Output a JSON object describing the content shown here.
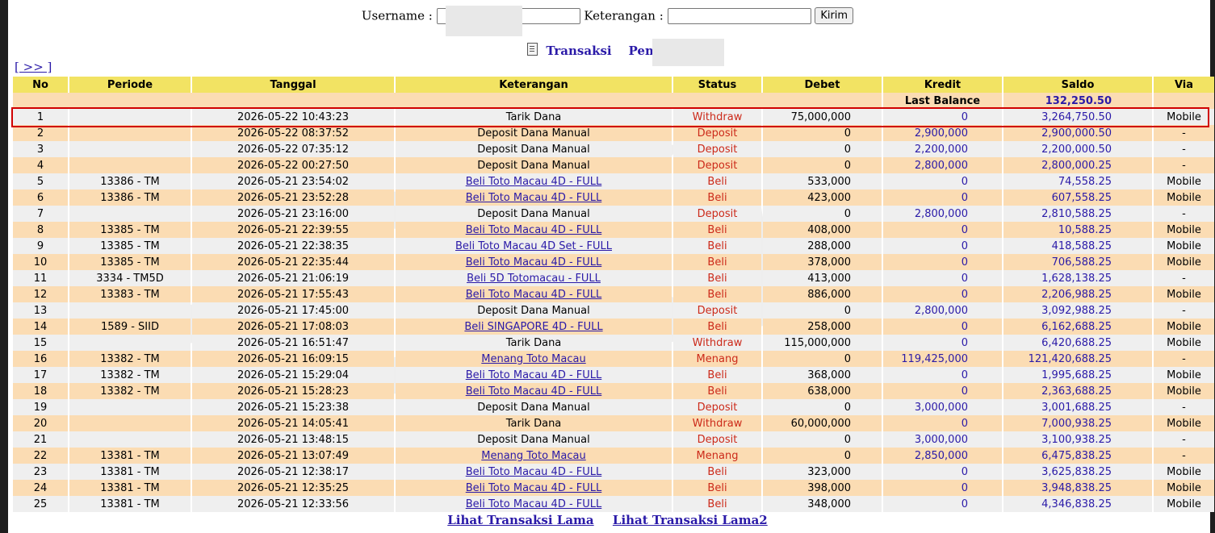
{
  "form": {
    "username_label": "Username :",
    "keterangan_label": "Keterangan :",
    "submit_label": "Kirim"
  },
  "title": {
    "transaksi": "Transaksi",
    "pemain": "Pemain :"
  },
  "nav": {
    "next": "[ >> ]"
  },
  "table": {
    "headers": [
      "No",
      "Periode",
      "Tanggal",
      "Keterangan",
      "Status",
      "Debet",
      "Kredit",
      "Saldo",
      "Via"
    ],
    "last_balance_label": "Last Balance",
    "last_balance_value": "132,250.50",
    "rows": [
      {
        "no": "1",
        "periode": "",
        "tanggal": "2026-05-22 10:43:23",
        "keterangan": "Tarik Dana",
        "link": false,
        "status": "Withdraw",
        "debet": "75,000,000",
        "kredit": "0",
        "saldo": "3,264,750.50",
        "via": "Mobile"
      },
      {
        "no": "2",
        "periode": "",
        "tanggal": "2026-05-22 08:37:52",
        "keterangan": "Deposit Dana Manual",
        "link": false,
        "status": "Deposit",
        "debet": "0",
        "kredit": "2,900,000",
        "saldo": "2,900,000.50",
        "via": "-"
      },
      {
        "no": "3",
        "periode": "",
        "tanggal": "2026-05-22 07:35:12",
        "keterangan": "Deposit Dana Manual",
        "link": false,
        "status": "Deposit",
        "debet": "0",
        "kredit": "2,200,000",
        "saldo": "2,200,000.50",
        "via": "-"
      },
      {
        "no": "4",
        "periode": "",
        "tanggal": "2026-05-22 00:27:50",
        "keterangan": "Deposit Dana Manual",
        "link": false,
        "status": "Deposit",
        "debet": "0",
        "kredit": "2,800,000",
        "saldo": "2,800,000.25",
        "via": "-"
      },
      {
        "no": "5",
        "periode": "13386 - TM",
        "tanggal": "2026-05-21 23:54:02",
        "keterangan": "Beli Toto Macau 4D - FULL",
        "link": true,
        "status": "Beli",
        "debet": "533,000",
        "kredit": "0",
        "saldo": "74,558.25",
        "via": "Mobile"
      },
      {
        "no": "6",
        "periode": "13386 - TM",
        "tanggal": "2026-05-21 23:52:28",
        "keterangan": "Beli Toto Macau 4D - FULL",
        "link": true,
        "status": "Beli",
        "debet": "423,000",
        "kredit": "0",
        "saldo": "607,558.25",
        "via": "Mobile"
      },
      {
        "no": "7",
        "periode": "",
        "tanggal": "2026-05-21 23:16:00",
        "keterangan": "Deposit Dana Manual",
        "link": false,
        "status": "Deposit",
        "debet": "0",
        "kredit": "2,800,000",
        "saldo": "2,810,588.25",
        "via": "-"
      },
      {
        "no": "8",
        "periode": "13385 - TM",
        "tanggal": "2026-05-21 22:39:55",
        "keterangan": "Beli Toto Macau 4D - FULL",
        "link": true,
        "status": "Beli",
        "debet": "408,000",
        "kredit": "0",
        "saldo": "10,588.25",
        "via": "Mobile"
      },
      {
        "no": "9",
        "periode": "13385 - TM",
        "tanggal": "2026-05-21 22:38:35",
        "keterangan": "Beli Toto Macau 4D Set - FULL",
        "link": true,
        "status": "Beli",
        "debet": "288,000",
        "kredit": "0",
        "saldo": "418,588.25",
        "via": "Mobile"
      },
      {
        "no": "10",
        "periode": "13385 - TM",
        "tanggal": "2026-05-21 22:35:44",
        "keterangan": "Beli Toto Macau 4D - FULL",
        "link": true,
        "status": "Beli",
        "debet": "378,000",
        "kredit": "0",
        "saldo": "706,588.25",
        "via": "Mobile"
      },
      {
        "no": "11",
        "periode": "3334 - TM5D",
        "tanggal": "2026-05-21 21:06:19",
        "keterangan": "Beli 5D Totomacau - FULL",
        "link": true,
        "status": "Beli",
        "debet": "413,000",
        "kredit": "0",
        "saldo": "1,628,138.25",
        "via": "-"
      },
      {
        "no": "12",
        "periode": "13383 - TM",
        "tanggal": "2026-05-21 17:55:43",
        "keterangan": "Beli Toto Macau 4D - FULL",
        "link": true,
        "status": "Beli",
        "debet": "886,000",
        "kredit": "0",
        "saldo": "2,206,988.25",
        "via": "Mobile"
      },
      {
        "no": "13",
        "periode": "",
        "tanggal": "2026-05-21 17:45:00",
        "keterangan": "Deposit Dana Manual",
        "link": false,
        "status": "Deposit",
        "debet": "0",
        "kredit": "2,800,000",
        "saldo": "3,092,988.25",
        "via": "-"
      },
      {
        "no": "14",
        "periode": "1589 - SIID",
        "tanggal": "2026-05-21 17:08:03",
        "keterangan": "Beli SINGAPORE 4D - FULL",
        "link": true,
        "status": "Beli",
        "debet": "258,000",
        "kredit": "0",
        "saldo": "6,162,688.25",
        "via": "Mobile"
      },
      {
        "no": "15",
        "periode": "",
        "tanggal": "2026-05-21 16:51:47",
        "keterangan": "Tarik Dana",
        "link": false,
        "status": "Withdraw",
        "debet": "115,000,000",
        "kredit": "0",
        "saldo": "6,420,688.25",
        "via": "Mobile"
      },
      {
        "no": "16",
        "periode": "13382 - TM",
        "tanggal": "2026-05-21 16:09:15",
        "keterangan": "Menang Toto Macau",
        "link": true,
        "status": "Menang",
        "debet": "0",
        "kredit": "119,425,000",
        "saldo": "121,420,688.25",
        "via": "-"
      },
      {
        "no": "17",
        "periode": "13382 - TM",
        "tanggal": "2026-05-21 15:29:04",
        "keterangan": "Beli Toto Macau 4D - FULL",
        "link": true,
        "status": "Beli",
        "debet": "368,000",
        "kredit": "0",
        "saldo": "1,995,688.25",
        "via": "Mobile"
      },
      {
        "no": "18",
        "periode": "13382 - TM",
        "tanggal": "2026-05-21 15:28:23",
        "keterangan": "Beli Toto Macau 4D - FULL",
        "link": true,
        "status": "Beli",
        "debet": "638,000",
        "kredit": "0",
        "saldo": "2,363,688.25",
        "via": "Mobile"
      },
      {
        "no": "19",
        "periode": "",
        "tanggal": "2026-05-21 15:23:38",
        "keterangan": "Deposit Dana Manual",
        "link": false,
        "status": "Deposit",
        "debet": "0",
        "kredit": "3,000,000",
        "saldo": "3,001,688.25",
        "via": "-"
      },
      {
        "no": "20",
        "periode": "",
        "tanggal": "2026-05-21 14:05:41",
        "keterangan": "Tarik Dana",
        "link": false,
        "status": "Withdraw",
        "debet": "60,000,000",
        "kredit": "0",
        "saldo": "7,000,938.25",
        "via": "Mobile"
      },
      {
        "no": "21",
        "periode": "",
        "tanggal": "2026-05-21 13:48:15",
        "keterangan": "Deposit Dana Manual",
        "link": false,
        "status": "Deposit",
        "debet": "0",
        "kredit": "3,000,000",
        "saldo": "3,100,938.25",
        "via": "-"
      },
      {
        "no": "22",
        "periode": "13381 - TM",
        "tanggal": "2026-05-21 13:07:49",
        "keterangan": "Menang Toto Macau",
        "link": true,
        "status": "Menang",
        "debet": "0",
        "kredit": "2,850,000",
        "saldo": "6,475,838.25",
        "via": "-"
      },
      {
        "no": "23",
        "periode": "13381 - TM",
        "tanggal": "2026-05-21 12:38:17",
        "keterangan": "Beli Toto Macau 4D - FULL",
        "link": true,
        "status": "Beli",
        "debet": "323,000",
        "kredit": "0",
        "saldo": "3,625,838.25",
        "via": "Mobile"
      },
      {
        "no": "24",
        "periode": "13381 - TM",
        "tanggal": "2026-05-21 12:35:25",
        "keterangan": "Beli Toto Macau 4D - FULL",
        "link": true,
        "status": "Beli",
        "debet": "398,000",
        "kredit": "0",
        "saldo": "3,948,838.25",
        "via": "Mobile"
      },
      {
        "no": "25",
        "periode": "13381 - TM",
        "tanggal": "2026-05-21 12:33:56",
        "keterangan": "Beli Toto Macau 4D - FULL",
        "link": true,
        "status": "Beli",
        "debet": "348,000",
        "kredit": "0",
        "saldo": "4,346,838.25",
        "via": "Mobile"
      }
    ]
  },
  "footer": {
    "link1": "Lihat Transaksi Lama",
    "link2": "Lihat Transaksi Lama2"
  },
  "colors": {
    "header_bg": "#f2e363",
    "row_odd": "#efefef",
    "row_even": "#fbdcb3",
    "link": "#2a1aa8",
    "status": "#cc2a1a",
    "highlight": "#d00000"
  }
}
